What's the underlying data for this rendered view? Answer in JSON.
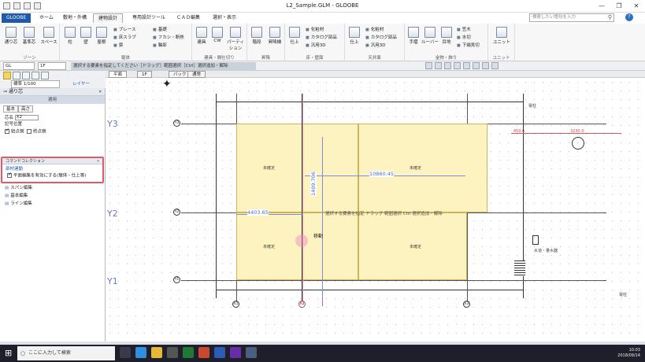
{
  "window": {
    "title": "L2_Sample.GLM - GLOOBE",
    "controls": [
      "—",
      "❐",
      "✕"
    ]
  },
  "ribbon_tabs": {
    "app": "GLOOBE",
    "items": [
      "ホーム",
      "敷地・外構",
      "建物設計",
      "専用設計ツール",
      "ＣＡＤ編集",
      "選択・表示"
    ],
    "active_index": 2
  },
  "search": {
    "placeholder": "検索したい語句を入力"
  },
  "ribbon": {
    "zone": {
      "buttons": [
        "通り芯",
        "基準芯",
        "スペース"
      ],
      "label": "ゾーン"
    },
    "body": {
      "buttons": [
        "柱",
        "壁",
        "屋根"
      ],
      "small": [
        "ブレース",
        "床スラブ",
        "梁",
        "基礎",
        "フカシ・断熱",
        "軸部"
      ],
      "label": "躯体"
    },
    "fittings": {
      "buttons": [
        "建具",
        "CW",
        "パーティション"
      ],
      "label": "建具・間仕切り"
    },
    "stairs": {
      "buttons": [
        "階段",
        "昇降機"
      ],
      "label": "昇降"
    },
    "floorwall": {
      "buttons": [
        "仕上"
      ],
      "small": [
        "化粧材",
        "カタログ部品",
        "汎用3D"
      ],
      "label": "床・壁面"
    },
    "ceiling": {
      "buttons": [
        "仕上"
      ],
      "small": [
        "化粧材",
        "カタログ部品",
        "汎用3D"
      ],
      "label": "天井面"
    },
    "hardware": {
      "buttons": [
        "手摺",
        "ルーバー",
        "目地"
      ],
      "small": [
        "笠木",
        "水切",
        "下端見切"
      ],
      "label": "金物・飾り"
    },
    "unit": {
      "buttons": [
        "ユニット"
      ],
      "label": "ユニット"
    }
  },
  "toolbar": {
    "floor": "GL",
    "level": "1F",
    "hint": "選択する要素を指定してください［ドラッグ］範囲選択［Ctrl］選択追加・解除",
    "scale": "標準 1/100",
    "layer": "レイヤー"
  },
  "canvas_tabs": [
    "平面",
    "1F",
    "バック",
    "通常"
  ],
  "panel": {
    "title": "通り芯",
    "apply": "適用",
    "tabs": [
      "基本",
      "高さ"
    ],
    "name_label": "芯名",
    "name_value": "X2",
    "symbol_pos_label": "記号位置",
    "start_label": "始点側",
    "end_label": "終点側",
    "command_collection": "コマンドコレクション",
    "member_edit": "部材連動",
    "plan_edit_label": "平面編集を有効にする(躯体・仕上等)",
    "menu": [
      "スパン編集",
      "基本編集",
      "ライン編集"
    ]
  },
  "drawing": {
    "axes_y": [
      "Y3",
      "Y2",
      "Y1"
    ],
    "axes_x_bubbles": [
      "X1",
      "X2",
      "X3"
    ],
    "y_bubbles": [
      "Y3",
      "Y2",
      "Y1"
    ],
    "room_labels": [
      "未確定",
      "未確定",
      "未確定",
      "未確定"
    ],
    "dims": {
      "horizontal_1": "10860.45",
      "horizontal_2": "4403.65",
      "vertical": "1409.706",
      "right": "3230.0",
      "left_small": "450.0"
    },
    "move_label": "移動",
    "right_labels": [
      "電柱",
      "水道・量水器",
      "電柱"
    ],
    "canvas_hint": "選択する要素を指定 ドラッグ 範囲選択 Ctrl 選択追加・解除"
  },
  "taskbar": {
    "search": "ここに入力して検索",
    "time": "10:03",
    "date": "2018/09/14"
  }
}
